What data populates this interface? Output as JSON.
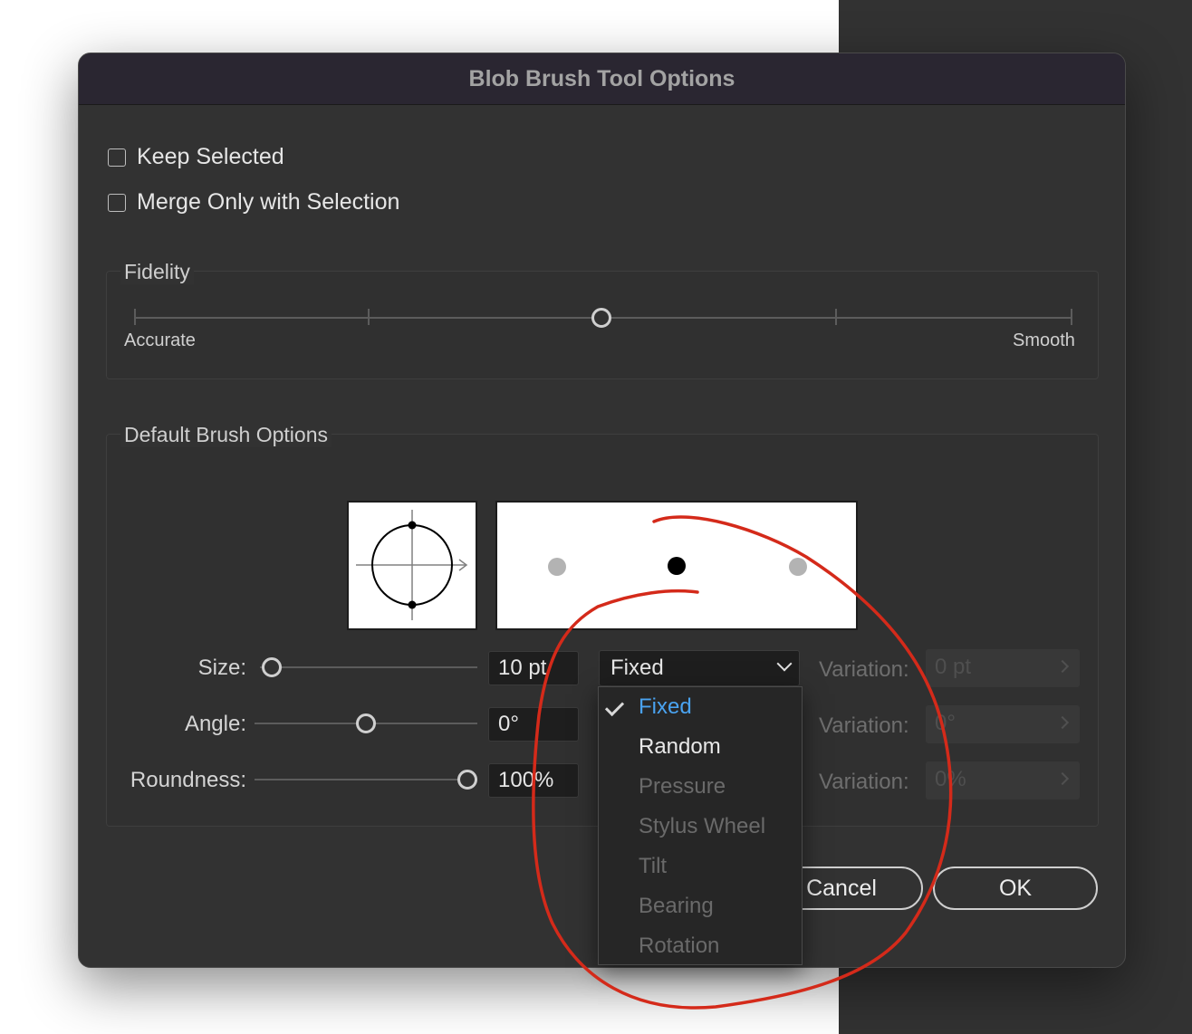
{
  "dialog": {
    "title": "Blob Brush Tool Options",
    "keep_selected": {
      "label": "Keep Selected",
      "checked": false
    },
    "merge_only": {
      "label": "Merge Only with Selection",
      "checked": false
    }
  },
  "fidelity": {
    "label": "Fidelity",
    "min_label": "Accurate",
    "max_label": "Smooth",
    "value_fraction": 0.5
  },
  "brush": {
    "label": "Default Brush Options",
    "size": {
      "label": "Size:",
      "value": "10 pt",
      "mode": "Fixed",
      "variation_label": "Variation:",
      "variation_value": "0 pt",
      "slider_fraction": 0.0
    },
    "angle": {
      "label": "Angle:",
      "value": "0°",
      "variation_label": "Variation:",
      "variation_value": "0°",
      "slider_fraction": 0.5
    },
    "roundness": {
      "label": "Roundness:",
      "value": "100%",
      "variation_label": "Variation:",
      "variation_value": "0%",
      "slider_fraction": 1.0
    }
  },
  "dropdown_menu": {
    "items": [
      {
        "label": "Fixed",
        "selected": true,
        "enabled": true
      },
      {
        "label": "Random",
        "selected": false,
        "enabled": true
      },
      {
        "label": "Pressure",
        "selected": false,
        "enabled": false
      },
      {
        "label": "Stylus Wheel",
        "selected": false,
        "enabled": false
      },
      {
        "label": "Tilt",
        "selected": false,
        "enabled": false
      },
      {
        "label": "Bearing",
        "selected": false,
        "enabled": false
      },
      {
        "label": "Rotation",
        "selected": false,
        "enabled": false
      }
    ]
  },
  "buttons": {
    "cancel": "Cancel",
    "ok": "OK"
  },
  "colors": {
    "selected_item": "#4aa3f0",
    "enabled_item": "#e8e8e8",
    "disabled_item": "#6a6a6a",
    "annotation": "#d42a1a"
  }
}
